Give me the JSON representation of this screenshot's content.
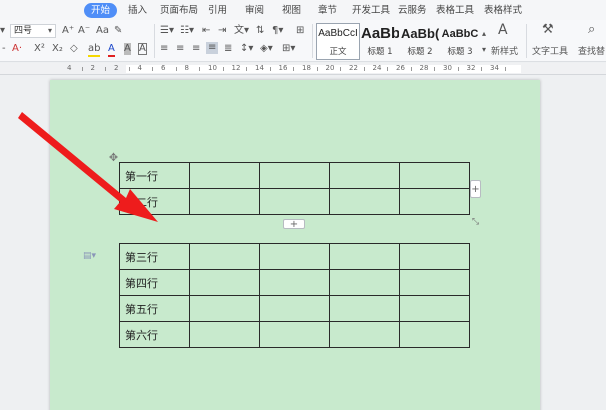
{
  "menu": {
    "tabs": [
      "开始",
      "插入",
      "页面布局",
      "引用",
      "审阅",
      "视图",
      "章节",
      "开发工具",
      "云服务",
      "表格工具",
      "表格样式"
    ],
    "active": "开始"
  },
  "toolbar": {
    "font_size": "四号",
    "grow_font": "A⁺",
    "shrink_font": "A⁻",
    "change_case": "Aa",
    "clear_format": "✎",
    "superscript": "X²",
    "subscript": "X₂",
    "font_color_label": "A",
    "highlight_label": "ab",
    "char_shading": "A",
    "char_border": "A"
  },
  "styles": [
    {
      "sample": "AaBbCcI",
      "name": "正文"
    },
    {
      "sample": "AaBb",
      "name": "标题 1"
    },
    {
      "sample": "AaBb(",
      "name": "标题 2"
    },
    {
      "sample": "AaBbC",
      "name": "标题 3"
    }
  ],
  "right_tools": {
    "new_style": "新样式",
    "text_tools": "文字工具",
    "find_replace": "查找替"
  },
  "ruler": {
    "labels": [
      "4",
      "2",
      "2",
      "4",
      "6",
      "8",
      "10",
      "12",
      "14",
      "16",
      "18",
      "20",
      "22",
      "24",
      "26",
      "28",
      "30",
      "32",
      "34"
    ]
  },
  "table_top": {
    "rows": [
      "第一行",
      "第二行"
    ]
  },
  "table_bottom": {
    "rows": [
      "第三行",
      "第四行",
      "第五行",
      "第六行"
    ]
  },
  "controls": {
    "move_handle": "✥",
    "add_row": "+",
    "add_col": "+",
    "resize": "⤡"
  },
  "colors": {
    "active_tab": "#4f8ef7",
    "page_background": "#c8eacd",
    "arrow": "#ee1c1c"
  }
}
